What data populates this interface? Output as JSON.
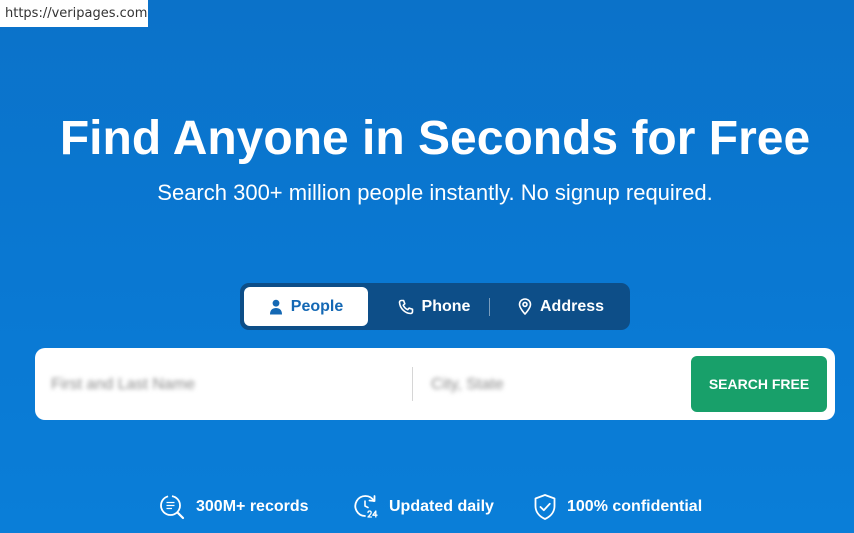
{
  "browser": {
    "url": "https://veripages.com"
  },
  "hero": {
    "title": "Find Anyone in Seconds for Free",
    "subtitle": "Search 300+ million people instantly. No signup required."
  },
  "search_tabs": [
    {
      "label": "People",
      "icon": "person-icon",
      "active": true
    },
    {
      "label": "Phone",
      "icon": "phone-icon",
      "active": false
    },
    {
      "label": "Address",
      "icon": "location-pin-icon",
      "active": false
    }
  ],
  "search_form": {
    "name_placeholder": "First and Last Name",
    "location_placeholder": "City, State",
    "button_label": "SEARCH FREE",
    "button_color": "#18A06A"
  },
  "features": [
    {
      "label": "300M+ records",
      "icon": "records-search-icon"
    },
    {
      "label": "Updated daily",
      "icon": "updated-24-icon"
    },
    {
      "label": "100% confidential",
      "icon": "shield-check-icon"
    }
  ],
  "colors": {
    "background": "#0A78D2",
    "tab_bar": "#0D4E88",
    "active_tab_text": "#1468B4"
  }
}
